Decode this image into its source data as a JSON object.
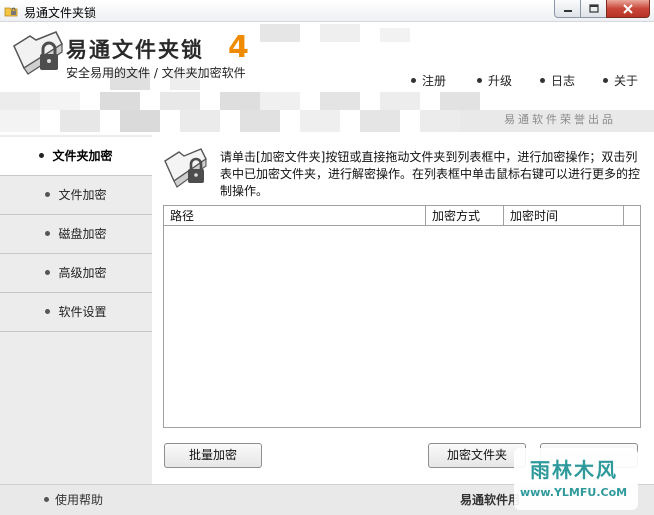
{
  "window": {
    "title": "易通文件夹锁",
    "icon": "app-lock-icon"
  },
  "header": {
    "brand": "易通文件夹锁",
    "version": "4",
    "slogan": "安全易用的文件 / 文件夹加密软件",
    "credit": "易通软件荣誉出品",
    "nav": [
      {
        "label": "注册"
      },
      {
        "label": "升级"
      },
      {
        "label": "日志"
      },
      {
        "label": "关于"
      }
    ]
  },
  "sidebar": {
    "items": [
      {
        "label": "文件夹加密",
        "active": true
      },
      {
        "label": "文件加密",
        "active": false
      },
      {
        "label": "磁盘加密",
        "active": false
      },
      {
        "label": "高级加密",
        "active": false
      },
      {
        "label": "软件设置",
        "active": false
      }
    ]
  },
  "main": {
    "hint": "请单击[加密文件夹]按钮或直接拖动文件夹到列表框中，进行加密操作；双击列表中已加密文件夹，进行解密操作。在列表框中单击鼠标右键可以进行更多的控制操作。",
    "columns": [
      "路径",
      "加密方式",
      "加密时间"
    ],
    "rows": [],
    "buttons": {
      "batch": "批量加密",
      "encrypt_folder": "加密文件夹"
    }
  },
  "footer": {
    "help": "使用帮助",
    "company": "易通软件用"
  },
  "watermark": {
    "text": "雨林木风",
    "url": "www.YLMFU.CoM"
  },
  "colors": {
    "accent": "#f08a00",
    "sidebar_bg": "#ececec",
    "tile": "#e6e6e6",
    "watermark": "#2f9a9c"
  }
}
